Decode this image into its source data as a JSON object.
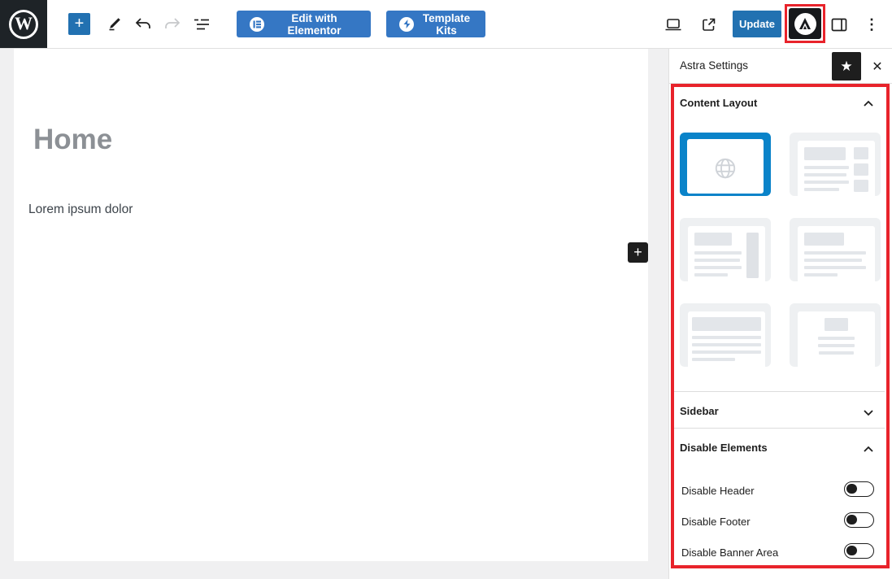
{
  "colors": {
    "accent_blue": "#2271b1",
    "elementor_blue": "#3577c4",
    "selected_layout_blue": "#0a83c9",
    "highlight_red": "#e8232b",
    "toolbar_black": "#1e1e1e"
  },
  "toolbar": {
    "add_label": "+",
    "elementor_label": "Edit with Elementor",
    "template_kits_label": "Template Kits",
    "update_label": "Update",
    "kebab": "⋮"
  },
  "canvas": {
    "title": "Home",
    "paragraph": "Lorem ipsum dolor",
    "inserter_label": "+"
  },
  "sidebar": {
    "title": "Astra Settings",
    "pin_icon": "★",
    "close_icon": "✕",
    "sections": [
      {
        "label": "Content Layout",
        "expanded": true
      },
      {
        "label": "Sidebar",
        "expanded": false
      },
      {
        "label": "Disable Elements",
        "expanded": true
      }
    ],
    "content_layout": {
      "selected_index": 0,
      "options": [
        "default-page-builder",
        "right-sidebar-widgets",
        "content-right-sidebar",
        "normal-width",
        "stretched-full-width",
        "narrow-width"
      ]
    },
    "toggles": [
      {
        "label": "Disable Header",
        "on": false
      },
      {
        "label": "Disable Footer",
        "on": false
      },
      {
        "label": "Disable Banner Area",
        "on": false
      }
    ]
  }
}
